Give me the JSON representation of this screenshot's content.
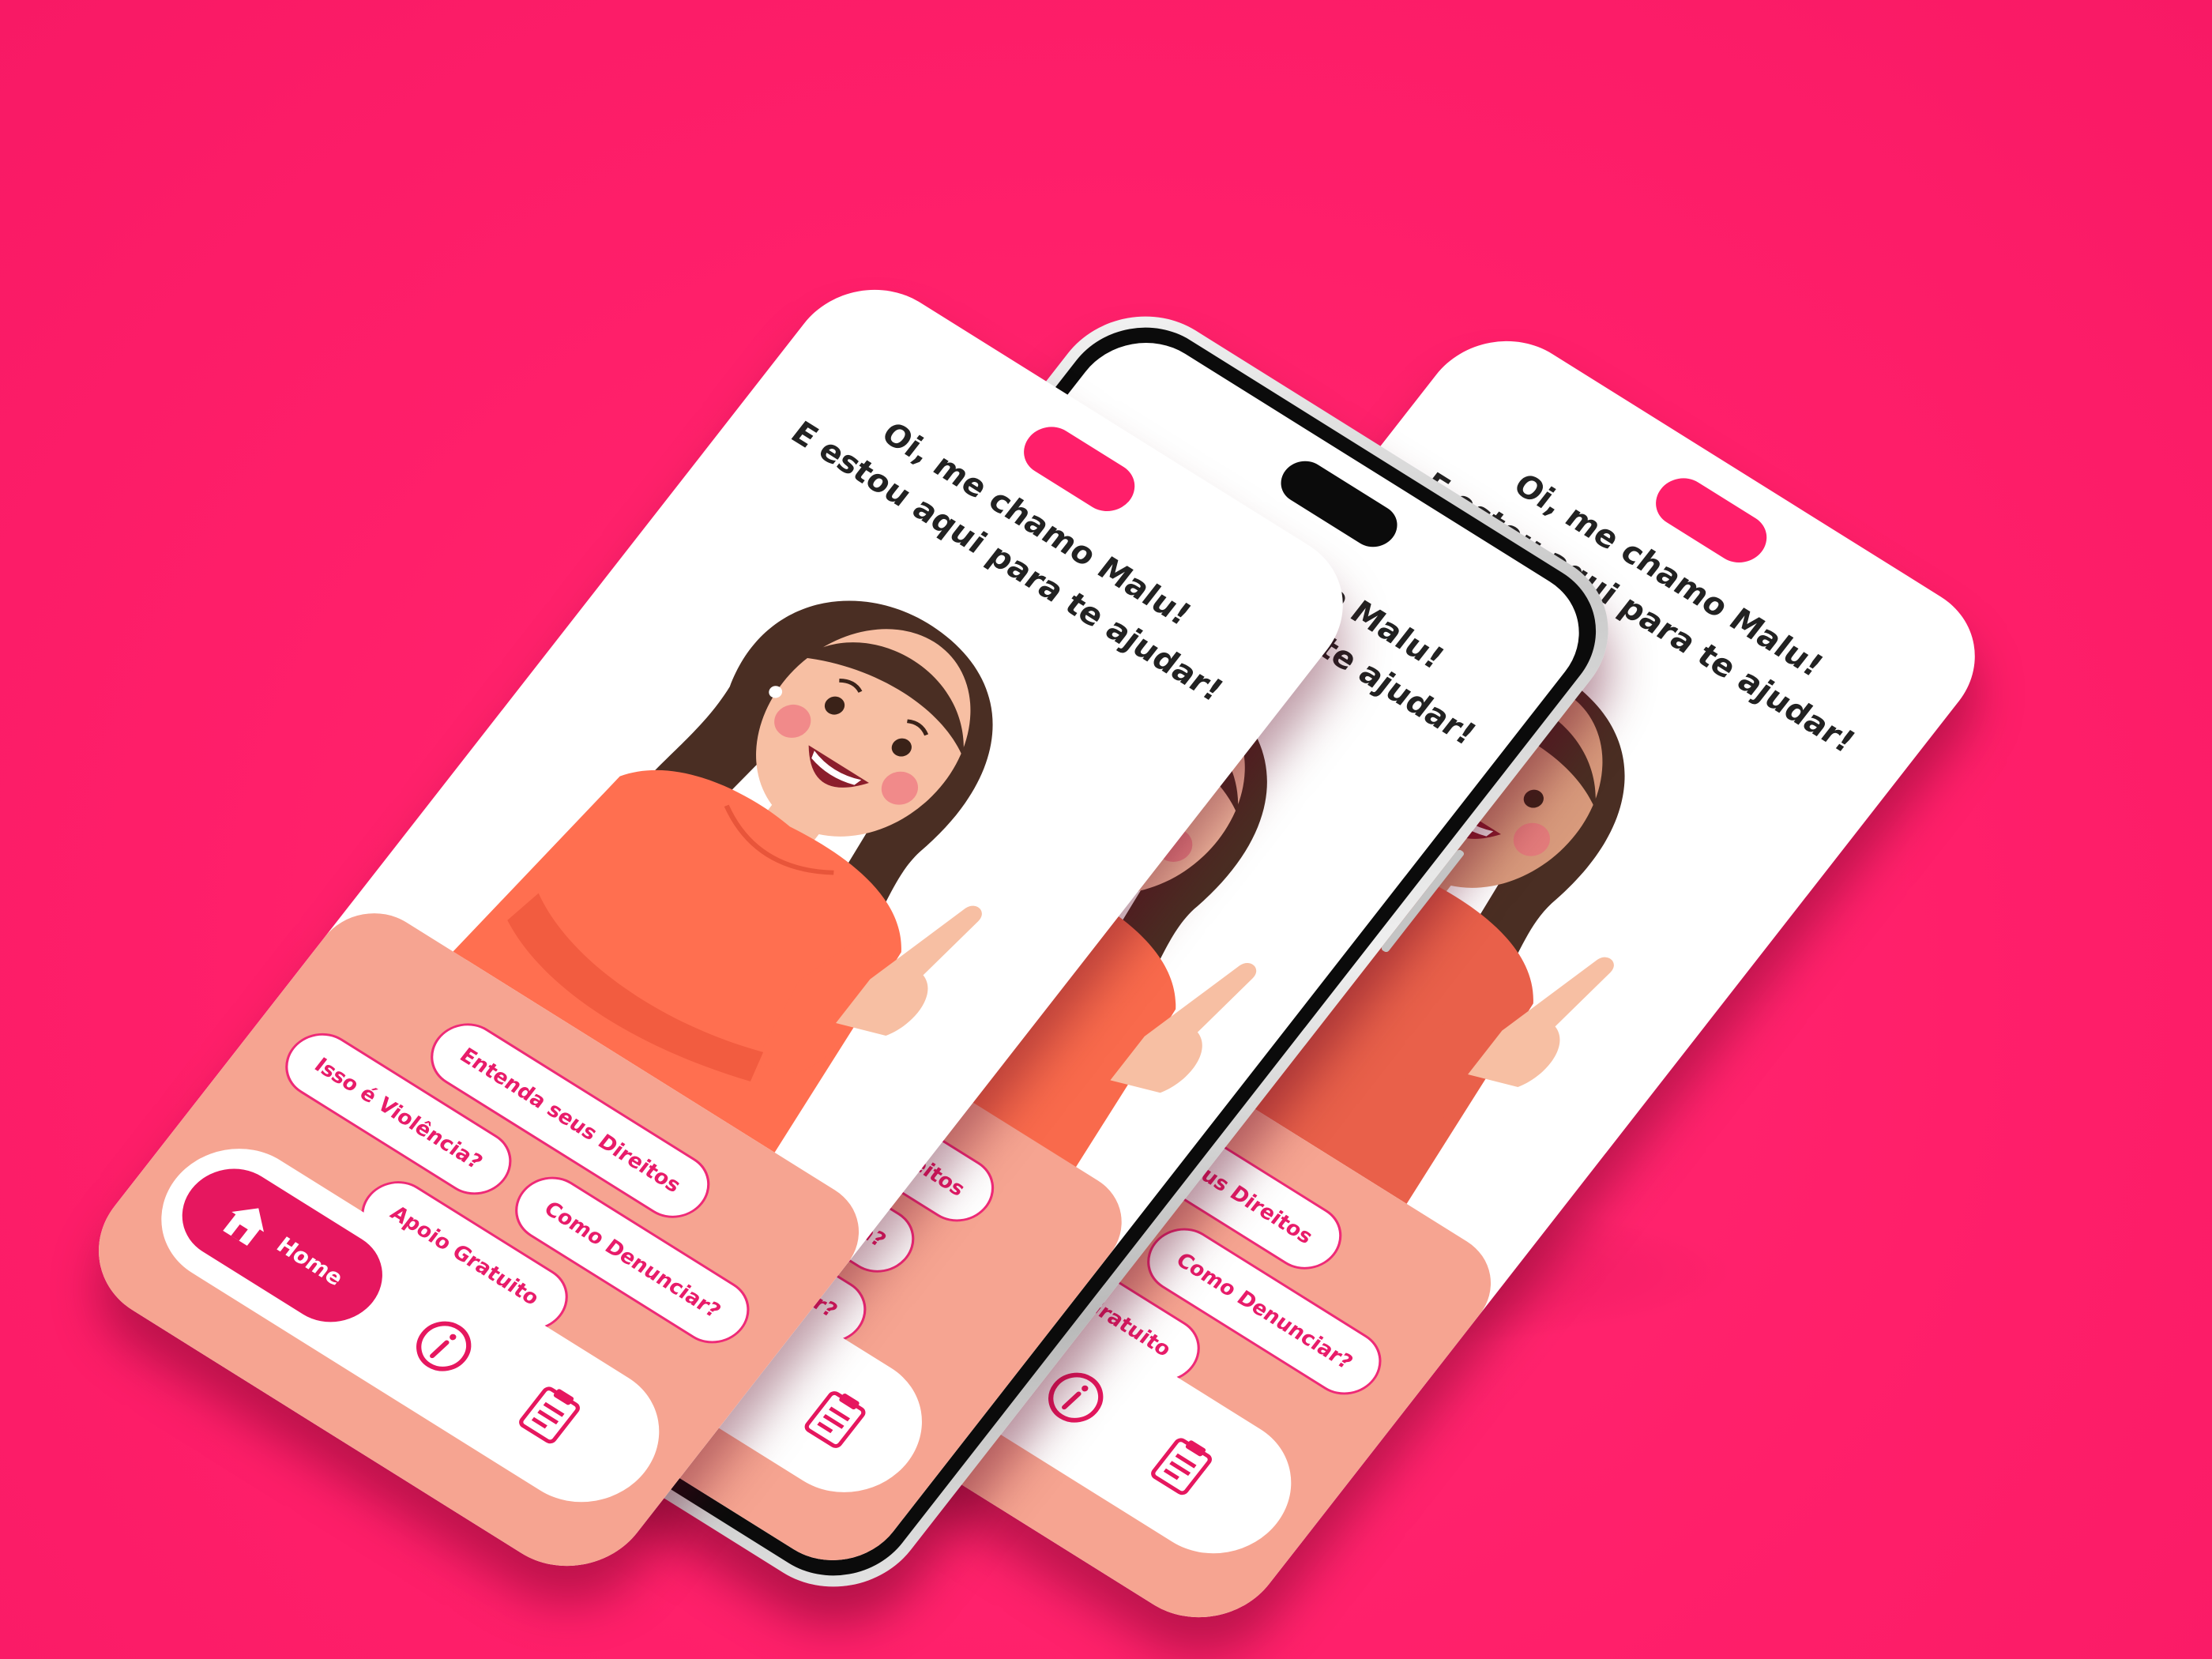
{
  "greeting": {
    "line1": "Oi, me chamo Malu!",
    "line2": "E estou aqui para te ajudar!"
  },
  "options": [
    {
      "label": "Entenda seus Direitos"
    },
    {
      "label": "Isso é Violência?"
    },
    {
      "label": "Como Denunciar?"
    },
    {
      "label": "Apoio Gratuito"
    }
  ],
  "nav": {
    "home_label": "Home",
    "items": [
      {
        "icon": "house-icon"
      },
      {
        "icon": "info-icon"
      },
      {
        "icon": "clipboard-icon"
      }
    ]
  },
  "colors": {
    "background": "#ff1f6a",
    "accent": "#e6175f",
    "panel": "#f6a491",
    "shirt": "#ff6f50",
    "hair": "#4a2e23",
    "skin": "#f7bfa3"
  }
}
